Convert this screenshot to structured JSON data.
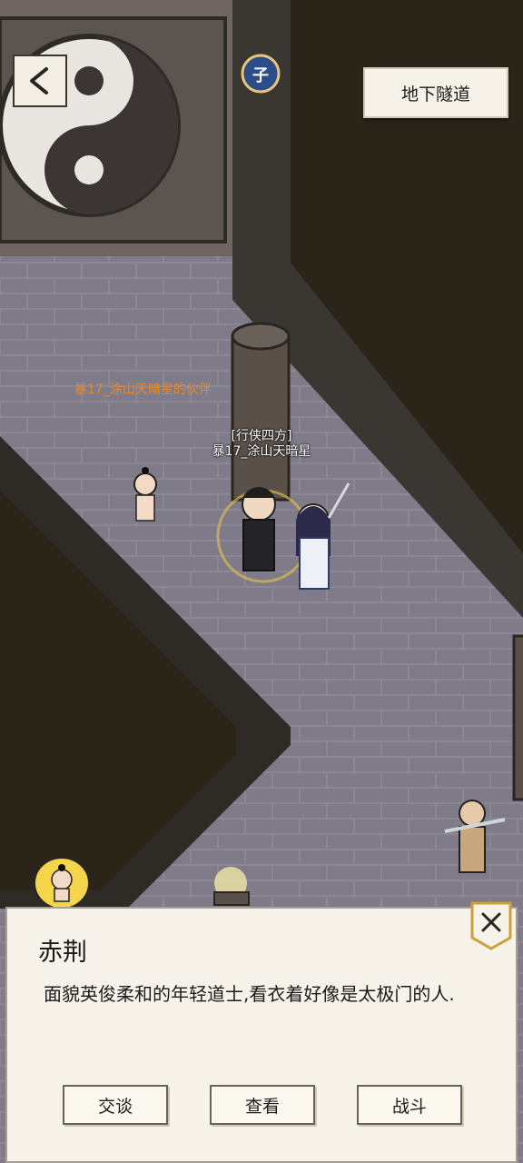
{
  "header": {
    "back_icon": "back-arrow-icon",
    "time_badge": "子",
    "location": "地下隧道"
  },
  "scene": {
    "companion_label": "暴17_涂山天暗星的伙伴",
    "player_title": "[行侠四方]",
    "player_name": "暴17_涂山天暗星"
  },
  "dialog": {
    "npc_name": "赤荆",
    "description": "面貌英俊柔和的年轻道士,看衣着好像是太极门的人.",
    "buttons": [
      "交谈",
      "查看",
      "战斗"
    ],
    "close_icon": "close-icon"
  },
  "colors": {
    "floor": "#8a8694",
    "wall": "#2a2520",
    "orange_label": "#e48a2e",
    "dialog_bg": "#f7f3ea"
  }
}
